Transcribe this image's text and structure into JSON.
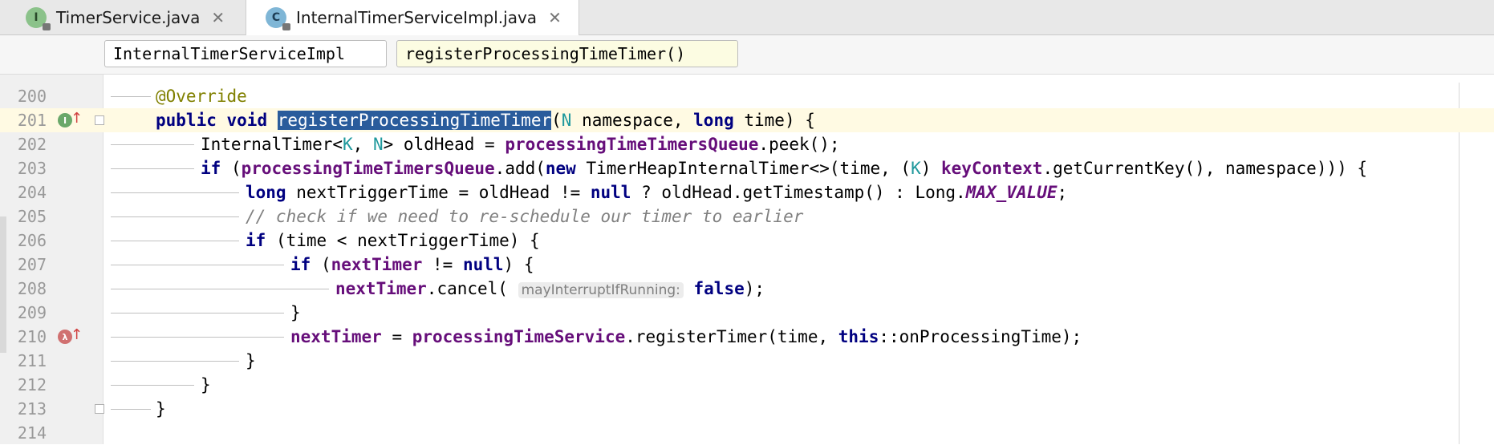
{
  "tabs": [
    {
      "label": "TimerService.java",
      "icon_letter": "I",
      "icon": "interface-file-icon",
      "close": "✕"
    },
    {
      "label": "InternalTimerServiceImpl.java",
      "icon_letter": "C",
      "icon": "class-file-icon",
      "close": "✕"
    }
  ],
  "breadcrumb": {
    "class_name": "InternalTimerServiceImpl",
    "method_name": "registerProcessingTimeTimer()"
  },
  "gutter": {
    "line_201_marker": "implements-method-icon",
    "line_210_marker": "lambda-icon",
    "marker_letter_i": "I",
    "marker_letter_l": "λ",
    "arrow": "↑"
  },
  "lines": [
    {
      "n": "200",
      "t": {
        "ann": "@Override"
      }
    },
    {
      "n": "201",
      "t": {
        "kw1": "public",
        "kw2": "void",
        "sel": "registerProcessingTimeTimer",
        "p1": "(",
        "tp": "N",
        "p2": " namespace, ",
        "kw3": "long",
        "p3": " time) {"
      }
    },
    {
      "n": "202",
      "t": {
        "p1": "InternalTimer<",
        "tp1": "K",
        "p2": ", ",
        "tp2": "N",
        "p3": "> oldHead = ",
        "fld": "processingTimeTimersQueue",
        "p4": ".peek();"
      }
    },
    {
      "n": "203",
      "t": {
        "kw1": "if",
        "p1": " (",
        "fld1": "processingTimeTimersQueue",
        "p2": ".add(",
        "kw2": "new",
        "p3": " TimerHeapInternalTimer<>(time, (",
        "tp": "K",
        "p4": ") ",
        "fld2": "keyContext",
        "p5": ".getCurrentKey(), namespace))) {"
      }
    },
    {
      "n": "204",
      "t": {
        "kw1": "long",
        "p1": " nextTriggerTime = oldHead != ",
        "kw2": "null",
        "p2": " ? oldHead.getTimestamp() : Long.",
        "sfld": "MAX_VALUE",
        "p3": ";"
      }
    },
    {
      "n": "205",
      "t": {
        "cmt": "// check if we need to re-schedule our timer to earlier"
      }
    },
    {
      "n": "206",
      "t": {
        "kw1": "if",
        "p1": " (time < nextTriggerTime) {"
      }
    },
    {
      "n": "207",
      "t": {
        "kw1": "if",
        "p1": " (",
        "fld": "nextTimer",
        "p2": " != ",
        "kw2": "null",
        "p3": ") {"
      }
    },
    {
      "n": "208",
      "t": {
        "fld": "nextTimer",
        "p1": ".cancel(",
        "hint": "mayInterruptIfRunning:",
        "kw": "false",
        "p2": ");"
      }
    },
    {
      "n": "209",
      "t": {
        "p1": "}"
      }
    },
    {
      "n": "210",
      "t": {
        "fld1": "nextTimer",
        "p1": " = ",
        "fld2": "processingTimeService",
        "p2": ".registerTimer(time, ",
        "kw": "this",
        "p3": "::onProcessingTime);"
      }
    },
    {
      "n": "211",
      "t": {
        "p1": "}"
      }
    },
    {
      "n": "212",
      "t": {
        "p1": "}"
      }
    },
    {
      "n": "213",
      "t": {
        "p1": "}"
      }
    },
    {
      "n": "214",
      "t": {}
    }
  ],
  "colors": {
    "keyword": "#000080",
    "annotation": "#808000",
    "field": "#660e7a",
    "type_param": "#20999d",
    "comment": "#808080",
    "selection": "#2a5c9c",
    "current_line": "#fffae3"
  }
}
